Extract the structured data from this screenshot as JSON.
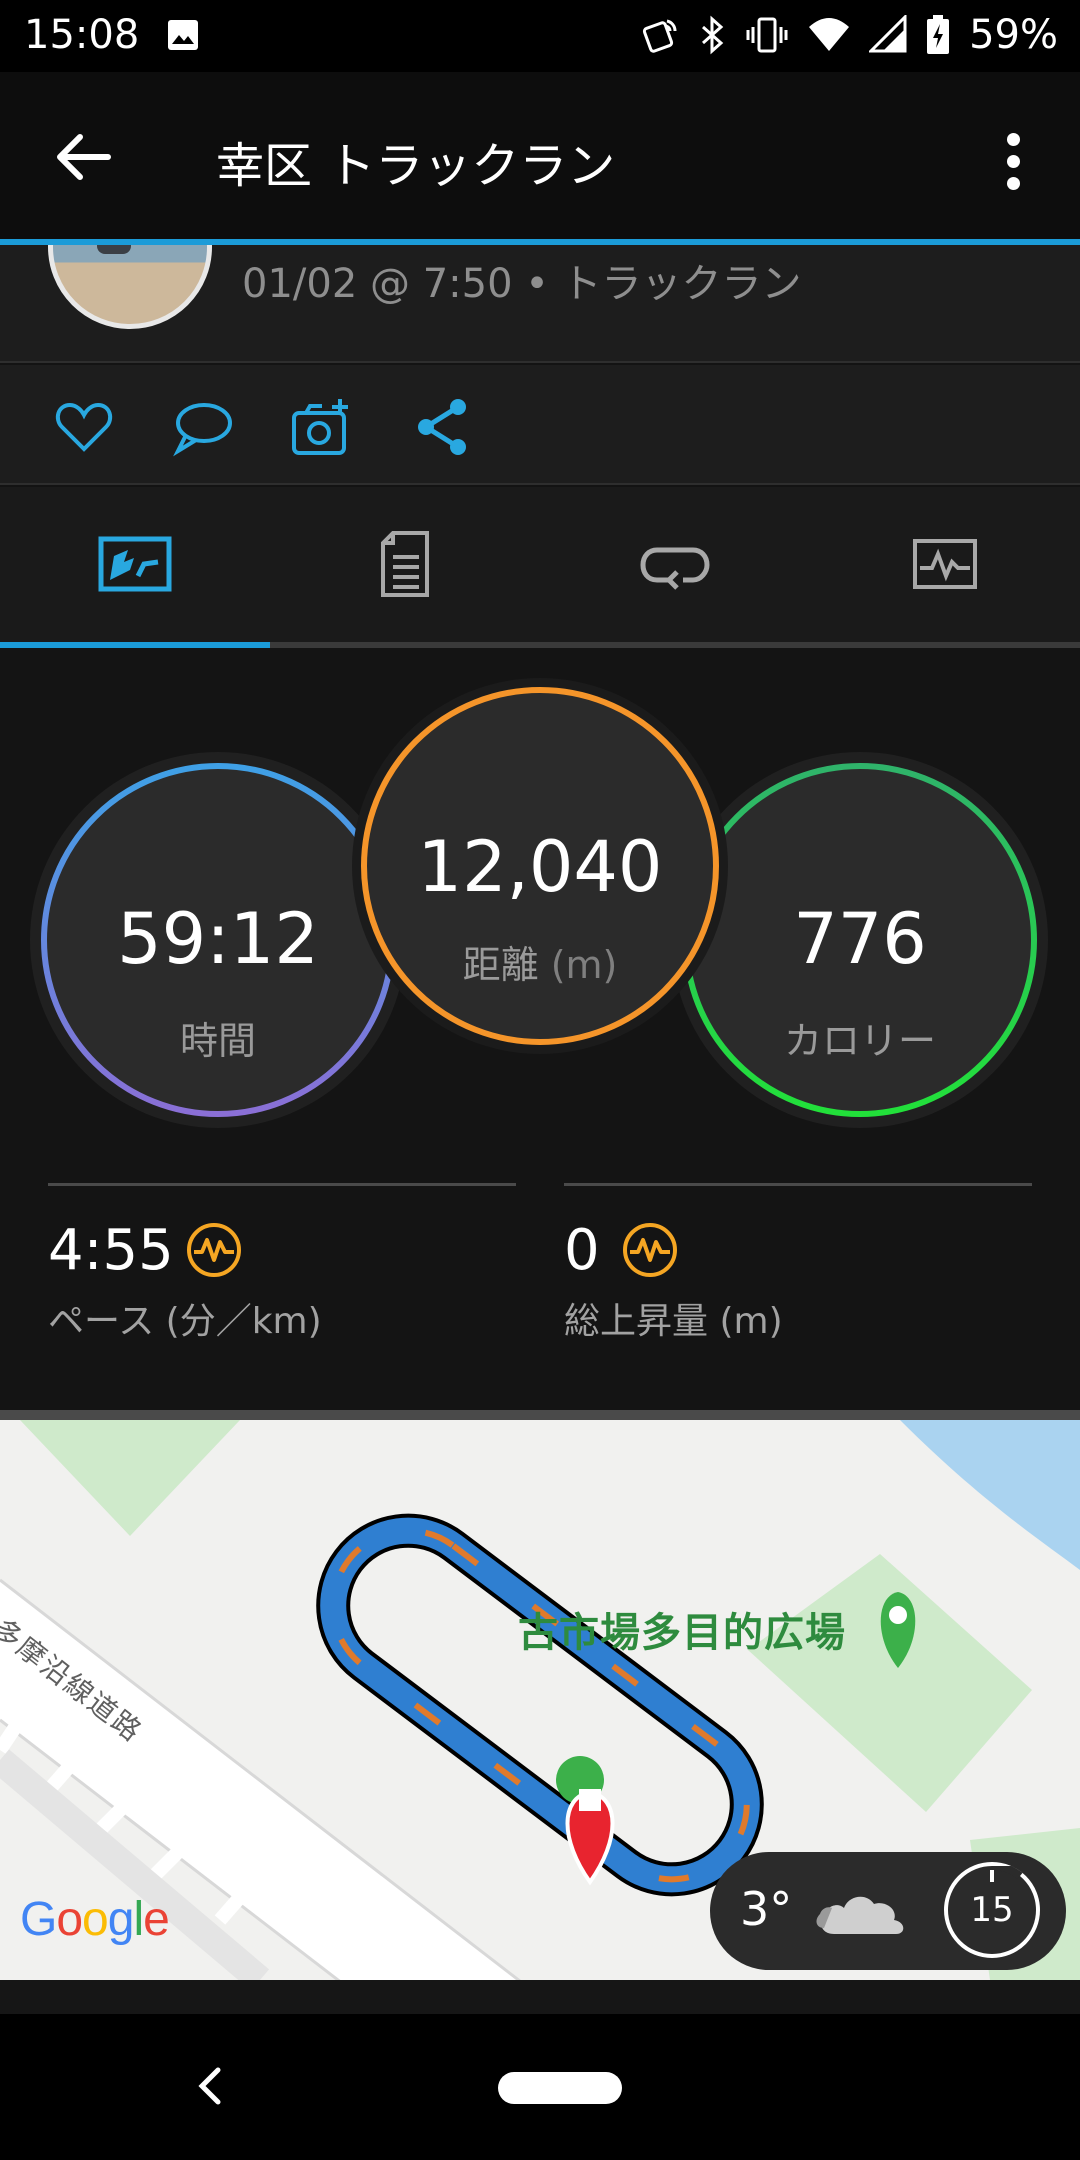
{
  "status_bar": {
    "time": "15:08",
    "battery": "59%",
    "icons": [
      "image-icon",
      "nfc-icon",
      "bluetooth-icon",
      "vibrate-icon",
      "wifi-icon",
      "signal-icon",
      "battery-charging-icon"
    ]
  },
  "app_bar": {
    "title": "幸区 トラックラン",
    "icons": [
      "back-arrow-icon",
      "more-vert-icon"
    ]
  },
  "activity": {
    "meta": "01/02 @ 7:50 • トラックラン"
  },
  "actions": {
    "icons": [
      "heart-icon",
      "comment-icon",
      "add-photo-icon",
      "share-icon"
    ]
  },
  "tabs": {
    "selected_index": 0,
    "icons": [
      "overview-icon",
      "details-icon",
      "laps-icon",
      "charts-icon"
    ]
  },
  "stats": {
    "time": {
      "value": "59:12",
      "label": "時間"
    },
    "distance": {
      "value": "12,040",
      "label": "距離",
      "unit": "(m)"
    },
    "calories": {
      "value": "776",
      "label": "カロリー"
    },
    "pace": {
      "value": "4:55",
      "label": "ペース",
      "unit": "(分／km)"
    },
    "elevation": {
      "value": "0",
      "label": "総上昇量",
      "unit": "(m)"
    },
    "colors": {
      "time_ring": [
        "#3fa0e6",
        "#8a6fd6"
      ],
      "distance_ring": "#f5952a",
      "calories_ring": [
        "#2fb36a",
        "#22e03a"
      ],
      "pulse_icon": "#f5a623"
    }
  },
  "map": {
    "place_label": "古市場多目的広場",
    "road_label": "多摩沿線道路",
    "google_logo": "Google",
    "weather": {
      "temp": "3°",
      "wind": "15"
    }
  },
  "nav_bar": {
    "icons": [
      "nav-back-icon",
      "home-pill"
    ]
  }
}
